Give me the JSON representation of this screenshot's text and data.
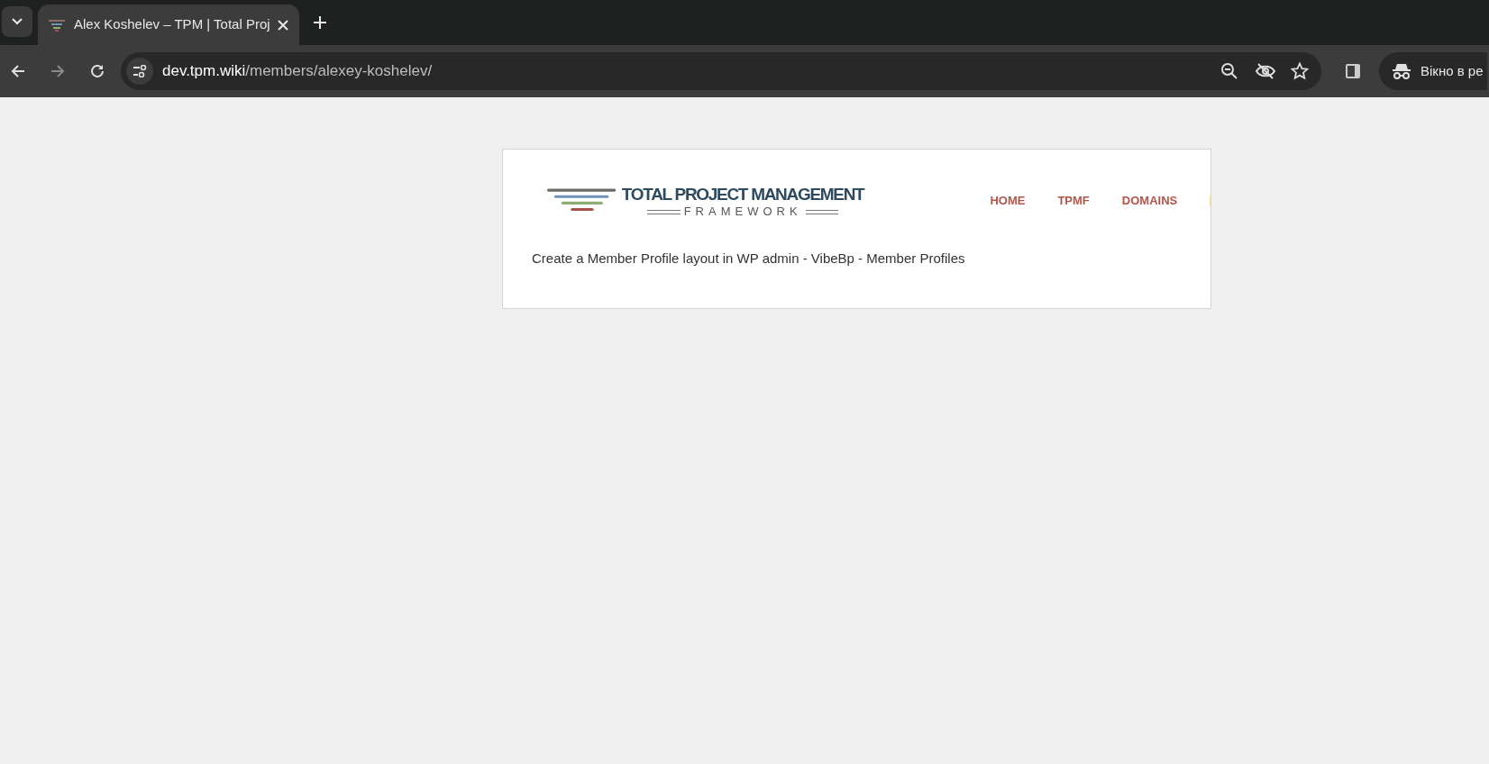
{
  "browser": {
    "tabs": [
      {
        "title": "Alex Koshelev – TPM | Total Proj",
        "selected": true
      }
    ],
    "address": {
      "host": "dev.tpm.wiki",
      "path": "/members/alexey-koshelev/"
    },
    "profile_chip": "Вікно в ре"
  },
  "site": {
    "logo": {
      "title": "TOTAL PROJECT MANAGEMENT",
      "subtitle": "FRAMEWORK"
    },
    "nav": [
      "HOME",
      "TPMF",
      "DOMAINS"
    ],
    "message": "Create a Member Profile layout in WP admin - VibeBp - Member Profiles"
  }
}
